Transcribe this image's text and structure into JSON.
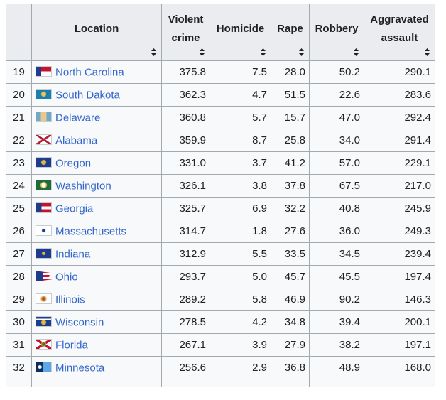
{
  "headers": {
    "index": "",
    "location": "Location",
    "violent_line1": "Violent",
    "violent_line2": "crime",
    "homicide": "Homicide",
    "rape": "Rape",
    "robbery": "Robbery",
    "aggravated_line1": "Aggravated",
    "aggravated_line2": "assault"
  },
  "sort_icon": "sort-updown-icon",
  "rows": [
    {
      "rank": "19",
      "location": "North Carolina",
      "flag": "north-carolina-flag-icon",
      "violent": "375.8",
      "homicide": "7.5",
      "rape": "28.0",
      "robbery": "50.2",
      "aggravated": "290.1"
    },
    {
      "rank": "20",
      "location": "South Dakota",
      "flag": "south-dakota-flag-icon",
      "violent": "362.3",
      "homicide": "4.7",
      "rape": "51.5",
      "robbery": "22.6",
      "aggravated": "283.6"
    },
    {
      "rank": "21",
      "location": "Delaware",
      "flag": "delaware-flag-icon",
      "violent": "360.8",
      "homicide": "5.7",
      "rape": "15.7",
      "robbery": "47.0",
      "aggravated": "292.4"
    },
    {
      "rank": "22",
      "location": "Alabama",
      "flag": "alabama-flag-icon",
      "violent": "359.9",
      "homicide": "8.7",
      "rape": "25.8",
      "robbery": "34.0",
      "aggravated": "291.4"
    },
    {
      "rank": "23",
      "location": "Oregon",
      "flag": "oregon-flag-icon",
      "violent": "331.0",
      "homicide": "3.7",
      "rape": "41.2",
      "robbery": "57.0",
      "aggravated": "229.1"
    },
    {
      "rank": "24",
      "location": "Washington",
      "flag": "washington-flag-icon",
      "violent": "326.1",
      "homicide": "3.8",
      "rape": "37.8",
      "robbery": "67.5",
      "aggravated": "217.0"
    },
    {
      "rank": "25",
      "location": "Georgia",
      "flag": "georgia-flag-icon",
      "violent": "325.7",
      "homicide": "6.9",
      "rape": "32.2",
      "robbery": "40.8",
      "aggravated": "245.9"
    },
    {
      "rank": "26",
      "location": "Massachusetts",
      "flag": "massachusetts-flag-icon",
      "violent": "314.7",
      "homicide": "1.8",
      "rape": "27.6",
      "robbery": "36.0",
      "aggravated": "249.3"
    },
    {
      "rank": "27",
      "location": "Indiana",
      "flag": "indiana-flag-icon",
      "violent": "312.9",
      "homicide": "5.5",
      "rape": "33.5",
      "robbery": "34.5",
      "aggravated": "239.4"
    },
    {
      "rank": "28",
      "location": "Ohio",
      "flag": "ohio-flag-icon",
      "violent": "293.7",
      "homicide": "5.0",
      "rape": "45.7",
      "robbery": "45.5",
      "aggravated": "197.4"
    },
    {
      "rank": "29",
      "location": "Illinois",
      "flag": "illinois-flag-icon",
      "violent": "289.2",
      "homicide": "5.8",
      "rape": "46.9",
      "robbery": "90.2",
      "aggravated": "146.3"
    },
    {
      "rank": "30",
      "location": "Wisconsin",
      "flag": "wisconsin-flag-icon",
      "violent": "278.5",
      "homicide": "4.2",
      "rape": "34.8",
      "robbery": "39.4",
      "aggravated": "200.1"
    },
    {
      "rank": "31",
      "location": "Florida",
      "flag": "florida-flag-icon",
      "violent": "267.1",
      "homicide": "3.9",
      "rape": "27.9",
      "robbery": "38.2",
      "aggravated": "197.1"
    },
    {
      "rank": "32",
      "location": "Minnesota",
      "flag": "minnesota-flag-icon",
      "violent": "256.6",
      "homicide": "2.9",
      "rape": "36.8",
      "robbery": "48.9",
      "aggravated": "168.0"
    }
  ],
  "colors": {
    "link": "#3366cc",
    "header_bg": "#eaecf0",
    "cell_bg": "#f8f9fa",
    "border": "#a2a9b1",
    "text": "#202122"
  }
}
